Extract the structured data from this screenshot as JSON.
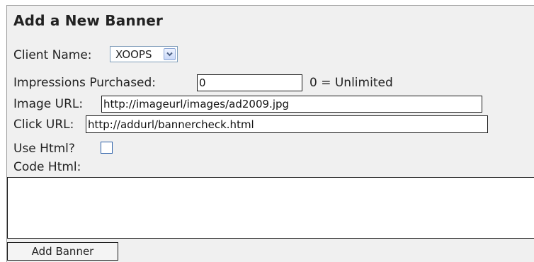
{
  "form": {
    "title": "Add a New Banner",
    "client_name": {
      "label": "Client Name:",
      "selected": "XOOPS"
    },
    "impressions": {
      "label": "Impressions Purchased:",
      "value": "0",
      "hint": "0 = Unlimited"
    },
    "image_url": {
      "label": "Image URL:",
      "value": "http://imageurl/images/ad2009.jpg"
    },
    "click_url": {
      "label": "Click URL:",
      "value": "http://addurl/bannercheck.html"
    },
    "use_html": {
      "label": "Use Html?",
      "checked": false
    },
    "code_html": {
      "label": "Code Html:",
      "value": ""
    },
    "submit_label": "Add Banner"
  },
  "colors": {
    "panel_bg": "#f0f0f0",
    "checkbox_border": "#2b5fa8",
    "select_border": "#7f9db9"
  }
}
